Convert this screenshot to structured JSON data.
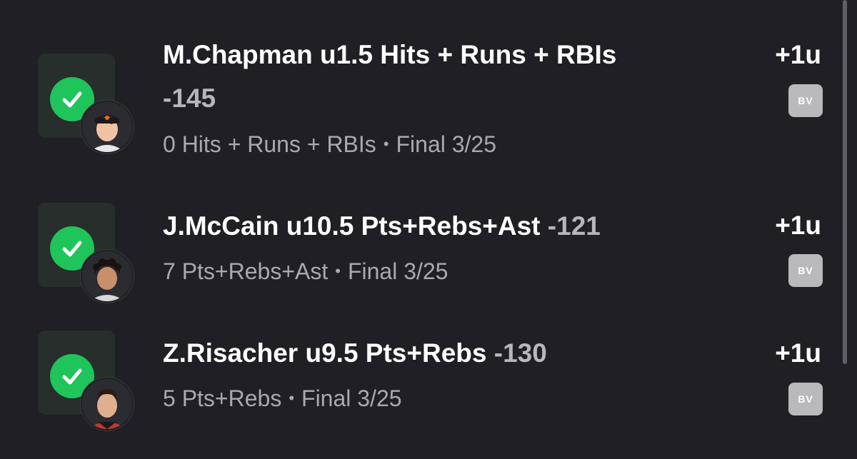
{
  "bets": [
    {
      "status": "won",
      "player": "M.Chapman",
      "line": "u1.5 Hits + Runs + RBIs",
      "odds": "-145",
      "result_stat": "0 Hits + Runs + RBIs",
      "result_status": "Final 3/25",
      "units": "+1u",
      "book": "BV",
      "avatar_icon": "player-headshot-orange-cap"
    },
    {
      "status": "won",
      "player": "J.McCain",
      "line": "u10.5 Pts+Rebs+Ast",
      "odds": "-121",
      "result_stat": "7 Pts+Rebs+Ast",
      "result_status": "Final 3/25",
      "units": "+1u",
      "book": "BV",
      "avatar_icon": "player-headshot-curly-hair"
    },
    {
      "status": "won",
      "player": "Z.Risacher",
      "line": "u9.5 Pts+Rebs",
      "odds": "-130",
      "result_stat": "5 Pts+Rebs",
      "result_status": "Final 3/25",
      "units": "+1u",
      "book": "BV",
      "avatar_icon": "player-headshot-short-hair"
    }
  ],
  "separator": "•",
  "colors": {
    "background": "#1f1f25",
    "success_green": "#1fc45a",
    "muted_text": "#a9a9b0",
    "badge_gray": "#b9b9bd"
  }
}
